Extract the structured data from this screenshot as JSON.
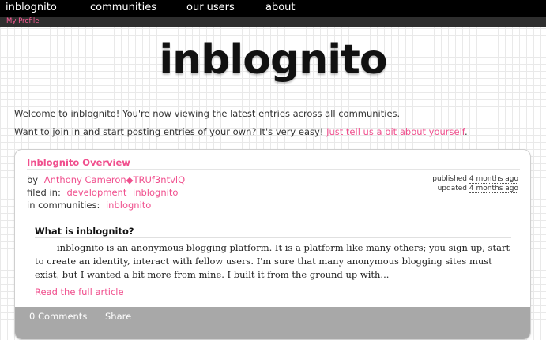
{
  "nav": {
    "items": [
      {
        "label": "inblognito"
      },
      {
        "label": "communities"
      },
      {
        "label": "our users"
      },
      {
        "label": "about"
      }
    ],
    "sub_item": "My Profile"
  },
  "logo": "inblognito",
  "intro": {
    "line1": "Welcome to inblognito! You're now viewing the latest entries across all communities.",
    "line2_text": "Want to join in and start posting entries of your own? It's very easy!",
    "line2_link": "Just tell us a bit about yourself",
    "line2_end": "."
  },
  "entry": {
    "title": "Inblognito Overview",
    "by_label": "by",
    "author": "Anthony Cameron◆TRUf3ntvlQ",
    "filed_label": "filed in:",
    "tags": [
      "development",
      "inblognito"
    ],
    "communities_label": "in communities:",
    "communities": [
      "inblognito"
    ],
    "published_label": "published",
    "published_ago": "4 months ago",
    "updated_label": "updated",
    "updated_ago": "4 months ago",
    "section_heading": "What is inblognito?",
    "excerpt": "inblognito is an anonymous blogging platform. It is a platform like many others; you sign up, start to create an identity, interact with fellow users. I'm sure that many anonymous blogging sites must exist, but I wanted a bit more from mine. I built it from the ground up with...",
    "read_more": "Read the full article",
    "comments_label": "0 Comments",
    "share_label": "Share"
  },
  "colors": {
    "accent": "#f0508e",
    "nav_bg": "#000000",
    "subnav_bg": "#2e2e2e",
    "footer_bg": "#a8a8a8"
  }
}
